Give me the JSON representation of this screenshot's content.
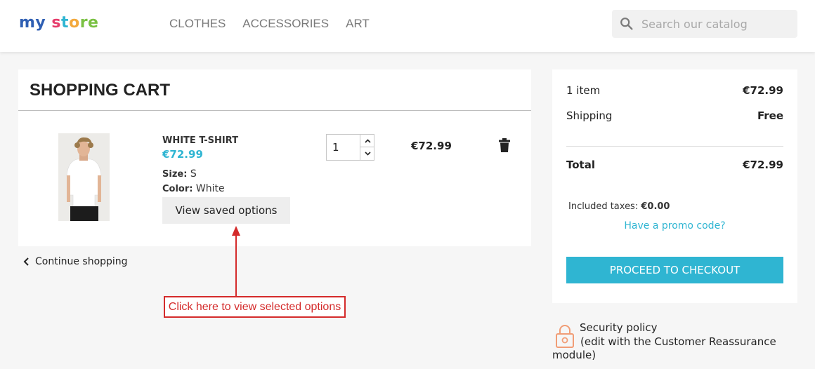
{
  "header": {
    "logo_parts": [
      "my",
      " s",
      "t",
      "o",
      "re"
    ],
    "nav": [
      "CLOTHES",
      "ACCESSORIES",
      "ART"
    ],
    "search_placeholder": "Search our catalog"
  },
  "cart": {
    "title": "SHOPPING CART",
    "item": {
      "name": "WHITE T-SHIRT",
      "price": "€72.99",
      "size_label": "Size:",
      "size_value": "S",
      "color_label": "Color:",
      "color_value": "White",
      "options_button": "View saved options",
      "quantity": "1",
      "line_total": "€72.99"
    },
    "continue_label": "Continue shopping"
  },
  "annotation": {
    "callout_text": "Click here to view selected options",
    "color": "#d42b2b"
  },
  "summary": {
    "items_label": "1 item",
    "items_value": "€72.99",
    "shipping_label": "Shipping",
    "shipping_value": "Free",
    "total_label": "Total",
    "total_value": "€72.99",
    "taxes_label": "Included taxes:",
    "taxes_value": "€0.00",
    "promo_link": "Have a promo code?",
    "checkout_button": "PROCEED TO CHECKOUT"
  },
  "reassurance": {
    "title": "Security policy",
    "desc_line1": "(edit with the Customer Reassurance",
    "desc_line2": "module)"
  },
  "colors": {
    "accent": "#2fb5d2",
    "background": "#f6f6f6"
  }
}
